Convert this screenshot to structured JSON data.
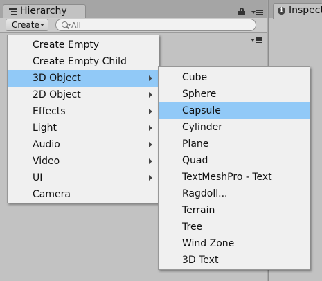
{
  "hierarchy": {
    "tab_label": "Hierarchy",
    "create_label": "Create",
    "search_placeholder": "All"
  },
  "inspector": {
    "tab_label": "Inspector"
  },
  "create_menu": {
    "items": [
      {
        "label": "Create Empty",
        "has_submenu": false
      },
      {
        "label": "Create Empty Child",
        "has_submenu": false
      },
      {
        "label": "3D Object",
        "has_submenu": true,
        "highlighted": true
      },
      {
        "label": "2D Object",
        "has_submenu": true
      },
      {
        "label": "Effects",
        "has_submenu": true
      },
      {
        "label": "Light",
        "has_submenu": true
      },
      {
        "label": "Audio",
        "has_submenu": true
      },
      {
        "label": "Video",
        "has_submenu": true
      },
      {
        "label": "UI",
        "has_submenu": true
      },
      {
        "label": "Camera",
        "has_submenu": false
      }
    ]
  },
  "object3d_menu": {
    "items": [
      {
        "label": "Cube"
      },
      {
        "label": "Sphere"
      },
      {
        "label": "Capsule",
        "highlighted": true
      },
      {
        "label": "Cylinder"
      },
      {
        "label": "Plane"
      },
      {
        "label": "Quad"
      },
      {
        "label": "TextMeshPro - Text"
      },
      {
        "label": "Ragdoll..."
      },
      {
        "label": "Terrain"
      },
      {
        "label": "Tree"
      },
      {
        "label": "Wind Zone"
      },
      {
        "label": "3D Text"
      }
    ]
  },
  "colors": {
    "highlight": "#91c9f7",
    "menu_background": "#f0f0f0",
    "panel_background": "#c2c2c2"
  }
}
